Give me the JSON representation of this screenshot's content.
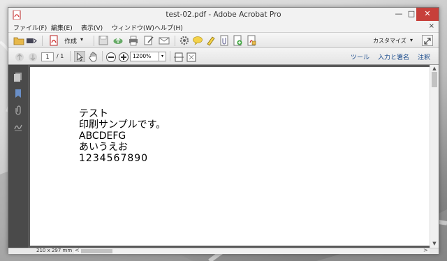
{
  "window": {
    "title": "test-02.pdf - Adobe Acrobat Pro",
    "minimize_glyph": "—",
    "maximize_glyph": "□",
    "close_glyph": "✕"
  },
  "menubar": {
    "items": [
      {
        "label": "ファイル(F)"
      },
      {
        "label": "編集(E)"
      },
      {
        "label": "表示(V)"
      },
      {
        "label": "ウィンドウ(W)"
      },
      {
        "label": "ヘルプ(H)"
      }
    ],
    "close_glyph": "×"
  },
  "toolbar": {
    "create_label": "作成",
    "create_arrow": "▾",
    "customize_label": "カスタマイズ",
    "customize_arrow": "▾"
  },
  "navbar": {
    "current_page": "1",
    "page_total": "/ 1",
    "zoom_value": "1200%",
    "zoom_arrow": "▾",
    "tools_link": "ツール",
    "fill_sign_link": "入力と署名",
    "comment_link": "注釈"
  },
  "document": {
    "lines": [
      "テスト",
      "印刷サンプルです。",
      "ABCDEFG",
      "あいうえお",
      "1234567890"
    ]
  },
  "statusbar": {
    "page_size": "210 x 297 mm",
    "left_arrow": "<",
    "right_arrow": ">"
  },
  "scrollbar": {
    "up_arrow": "▲",
    "down_arrow": "▼"
  },
  "colors": {
    "close_button": "#c7403b",
    "link_blue": "#1f4f8f",
    "navigation_panel": "#4a4a4a"
  }
}
